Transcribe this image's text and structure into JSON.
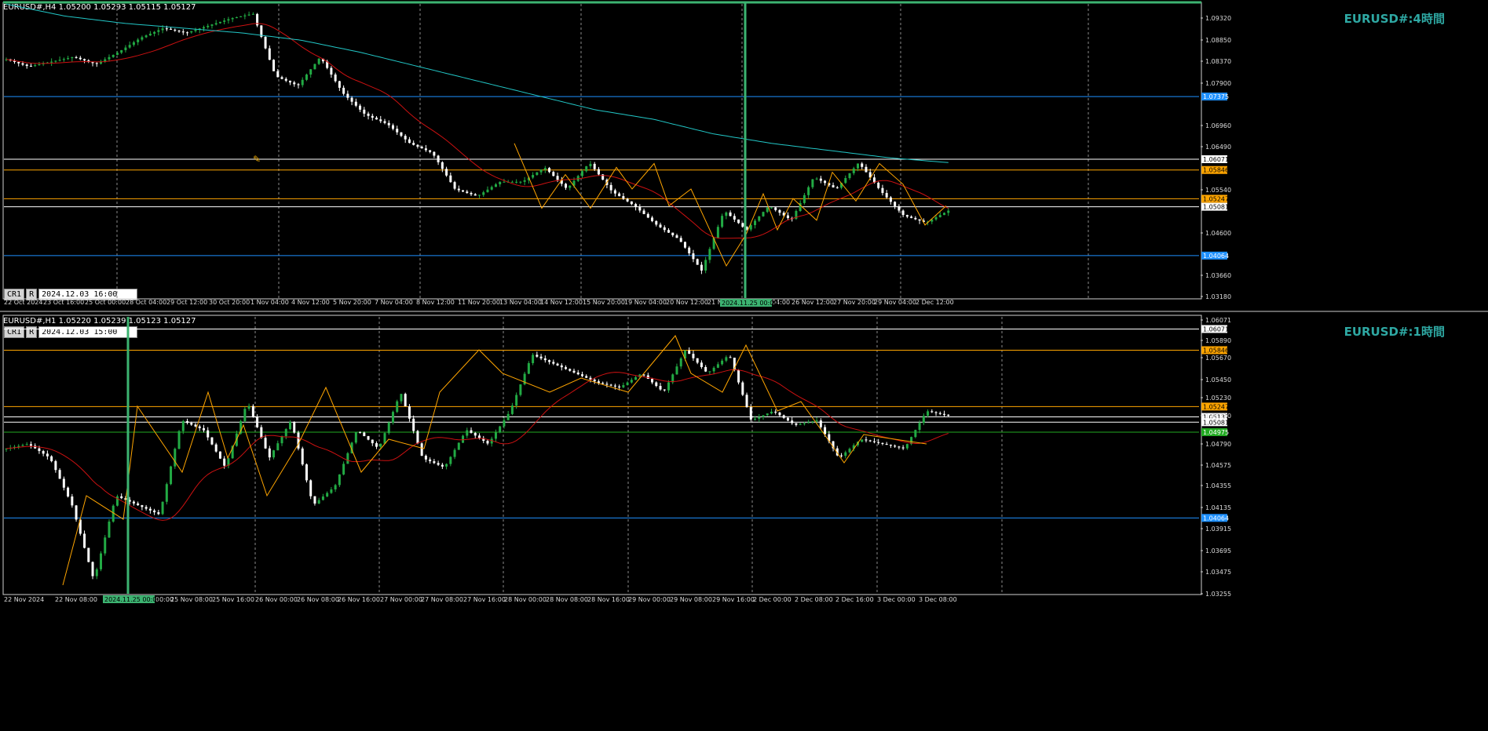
{
  "top_pane": {
    "header": "EURUSD#,H4  1.05200 1.05293 1.05115 1.05127",
    "title": "EURUSD#:4時間",
    "cr_label": "CR1",
    "r_label": "R",
    "timestamp": "2024.12.03 16:00",
    "cursor_label": "2024.11.25 00:00",
    "price_ticks": [
      "1.09320",
      "1.08850",
      "1.08370",
      "1.07900",
      "1.06960",
      "1.06490",
      "1.05540",
      "1.04600",
      "1.03660",
      "1.03180"
    ],
    "price_labels": [
      {
        "text": "1.07375",
        "price": 1.07375,
        "color": "#1e90ff"
      },
      {
        "text": "1.06071",
        "price": 1.06071,
        "color": "#ffffff"
      },
      {
        "text": "1.05846",
        "price": 1.05846,
        "color": "#ffa500"
      },
      {
        "text": "1.05247",
        "price": 1.05247,
        "color": "#ffa500"
      },
      {
        "text": "1.05081",
        "price": 1.05081,
        "color": "#ffffff"
      },
      {
        "text": "1.04064",
        "price": 1.04064,
        "color": "#1e90ff"
      }
    ],
    "time_labels": [
      "22 Oct 2024",
      "23 Oct 16:00",
      "25 Oct 00:00",
      "28 Oct 04:00",
      "29 Oct 12:00",
      "30 Oct 20:00",
      "1 Nov 04:00",
      "4 Nov 12:00",
      "5 Nov 20:00",
      "7 Nov 04:00",
      "8 Nov 12:00",
      "11 Nov 20:00",
      "13 Nov 04:00",
      "14 Nov 12:00",
      "15 Nov 20:00",
      "19 Nov 04:00",
      "20 Nov 12:00",
      "21 N",
      "04:00",
      "26 Nov 12:00",
      "27 Nov 20:00",
      "29 Nov 04:00",
      "2 Dec 12:00"
    ]
  },
  "bottom_pane": {
    "header": "EURUSD#,H1  1.05220 1.05239 1.05123 1.05127",
    "title": "EURUSD#:1時間",
    "cr_label": "CR1",
    "r_label": "R",
    "timestamp": "2024.12.03 15:00",
    "cursor_label": "2024.11.25 00:00",
    "price_ticks": [
      "1.06071",
      "1.05890",
      "1.05670",
      "1.05450",
      "1.05230",
      "1.05010",
      "1.04790",
      "1.04575",
      "1.04355",
      "1.04135",
      "1.03915",
      "1.03695",
      "1.03475",
      "1.03255"
    ],
    "price_labels": [
      {
        "text": "1.06071",
        "price": 1.06071,
        "color": "#ffffff"
      },
      {
        "text": "1.05846",
        "price": 1.05846,
        "color": "#ffa500"
      },
      {
        "text": "1.05247",
        "price": 1.05247,
        "color": "#ffa500"
      },
      {
        "text": "1.05137",
        "price": 1.05137,
        "color": "#ffffff"
      },
      {
        "text": "1.05081",
        "price": 1.05081,
        "color": "#ffffff"
      },
      {
        "text": "1.04975",
        "price": 1.04975,
        "color": "#22aa22"
      },
      {
        "text": "1.04064",
        "price": 1.04064,
        "color": "#1e90ff"
      }
    ],
    "time_labels": [
      "22 Nov 2024",
      "22 Nov 08:00",
      "22 No",
      "00:00",
      "25 Nov 08:00",
      "25 Nov 16:00",
      "26 Nov 00:00",
      "26 Nov 08:00",
      "26 Nov 16:00",
      "27 Nov 00:00",
      "27 Nov 08:00",
      "27 Nov 16:00",
      "28 Nov 00:00",
      "28 Nov 08:00",
      "28 Nov 16:00",
      "29 Nov 00:00",
      "29 Nov 08:00",
      "29 Nov 16:00",
      "2 Dec 00:00",
      "2 Dec 08:00",
      "2 Dec 16:00",
      "3 Dec 00:00",
      "3 Dec 08:00"
    ]
  },
  "colors": {
    "bull": "#22aa44",
    "bear": "#ffffff",
    "ma_fast": "#cc1111",
    "ma_slow": "#22c7c7",
    "zigzag": "#ffa500",
    "cursor": "#3cb371",
    "grid": "#8a8a8a"
  }
}
